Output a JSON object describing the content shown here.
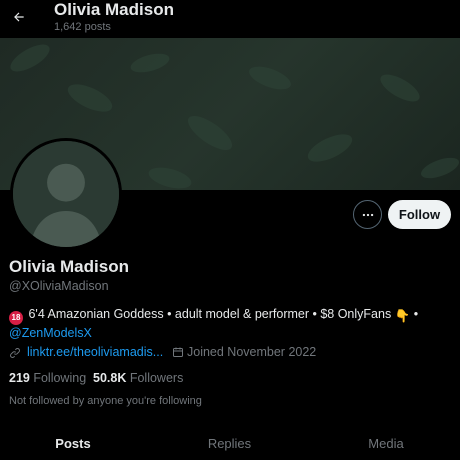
{
  "header": {
    "title": "Olivia Madison",
    "post_count": "1,642 posts",
    "back_icon": "arrow-left-icon"
  },
  "profile": {
    "display_name": "Olivia Madison",
    "handle": "@XOliviaMadison",
    "bio_age_badge": "18",
    "bio_text": "6'4 Amazonian Goddess • adult model & performer • $8 OnlyFans",
    "bio_emoji": "👇",
    "bio_suffix": " •",
    "bio_mention": "@ZenModelsX",
    "link": "linktr.ee/theoliviamadis...",
    "joined": "Joined November 2022",
    "following_count": "219",
    "following_label": "Following",
    "followers_count": "50.8K",
    "followers_label": "Followers",
    "not_followed": "Not followed by anyone you're following"
  },
  "actions": {
    "more_icon": "more-horizontal-icon",
    "follow_label": "Follow"
  },
  "tabs": [
    {
      "label": "Posts",
      "active": true
    },
    {
      "label": "Replies",
      "active": false
    },
    {
      "label": "Media",
      "active": false
    }
  ],
  "colors": {
    "background": "#000000",
    "text_primary": "#e7e9ea",
    "text_secondary": "#71767b",
    "link": "#1d9bf0",
    "follow_button_bg": "#eff3f4",
    "age_badge": "#d61f45"
  }
}
